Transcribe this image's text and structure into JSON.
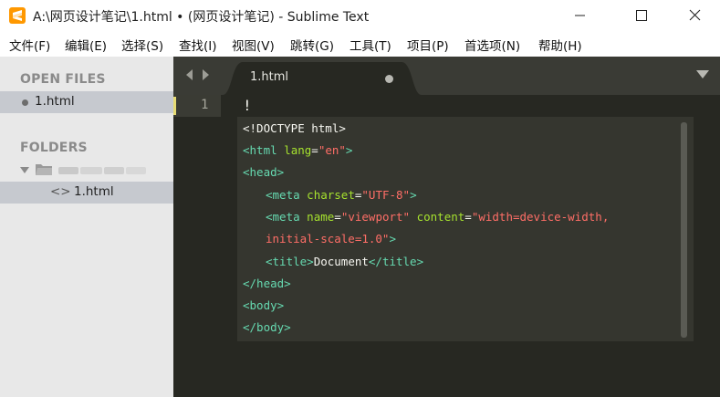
{
  "window": {
    "title": "A:\\网页设计笔记\\1.html • (网页设计笔记) - Sublime Text"
  },
  "menu": [
    "文件(F)",
    "编辑(E)",
    "选择(S)",
    "查找(I)",
    "视图(V)",
    "跳转(G)",
    "工具(T)",
    "项目(P)",
    "首选项(N)",
    "帮助(H)"
  ],
  "sidebar": {
    "open_files_header": "OPEN FILES",
    "open_file": "1.html",
    "folders_header": "FOLDERS",
    "folder_file": "1.html"
  },
  "tab": {
    "label": "1.html"
  },
  "editor": {
    "line_number": "1",
    "typed_text": "!"
  },
  "completion": {
    "doctype": "<!DOCTYPE html>",
    "html_open": "<html",
    "lang_attr": "lang",
    "lang_value": "\"en\"",
    "gt": ">",
    "head_open": "<head>",
    "meta1_open": "<meta",
    "charset_attr": "charset",
    "charset_value": "\"UTF-8\"",
    "meta2_open": "<meta",
    "name_attr": "name",
    "name_value": "\"viewport\"",
    "content_attr": "content",
    "content_value_1": "\"width=device-width,",
    "content_value_2": "initial-scale=1.0\"",
    "title_open": "<title>",
    "title_text": "Document",
    "title_close": "</title>",
    "head_close": "</head>",
    "body_open": "<body>",
    "body_close": "</body>"
  },
  "colors": {
    "editor_bg": "#272822",
    "tag": "#66d9b0",
    "attribute": "#a6e22e",
    "string": "#ff6e67",
    "accent_icon": "#ff9800"
  }
}
